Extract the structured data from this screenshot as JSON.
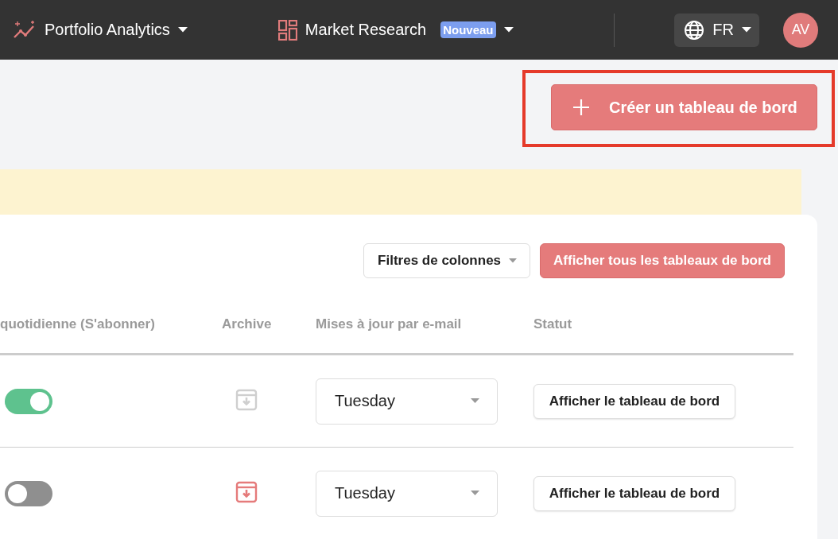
{
  "navbar": {
    "workspace": {
      "label": "Portfolio Analytics"
    },
    "project": {
      "label": "Market Research",
      "badge": "Nouveau"
    },
    "language": {
      "label": "FR"
    },
    "avatar": {
      "initials": "AV"
    }
  },
  "create_button": {
    "label": "Créer un tableau de bord",
    "highlighted": true
  },
  "toolbar": {
    "filters": "Filtres de colonnes",
    "show_all": "Afficher tous les tableaux de bord"
  },
  "table": {
    "columns": [
      "quotidienne (S'abonner)",
      "Archive",
      "Mises à jour par e-mail",
      "Statut"
    ],
    "rows": [
      {
        "subscribed": true,
        "archived": false,
        "email_day": "Tuesday",
        "action": "Afficher le tableau de bord"
      },
      {
        "subscribed": false,
        "archived": true,
        "email_day": "Tuesday",
        "action": "Afficher le tableau de bord"
      }
    ]
  }
}
